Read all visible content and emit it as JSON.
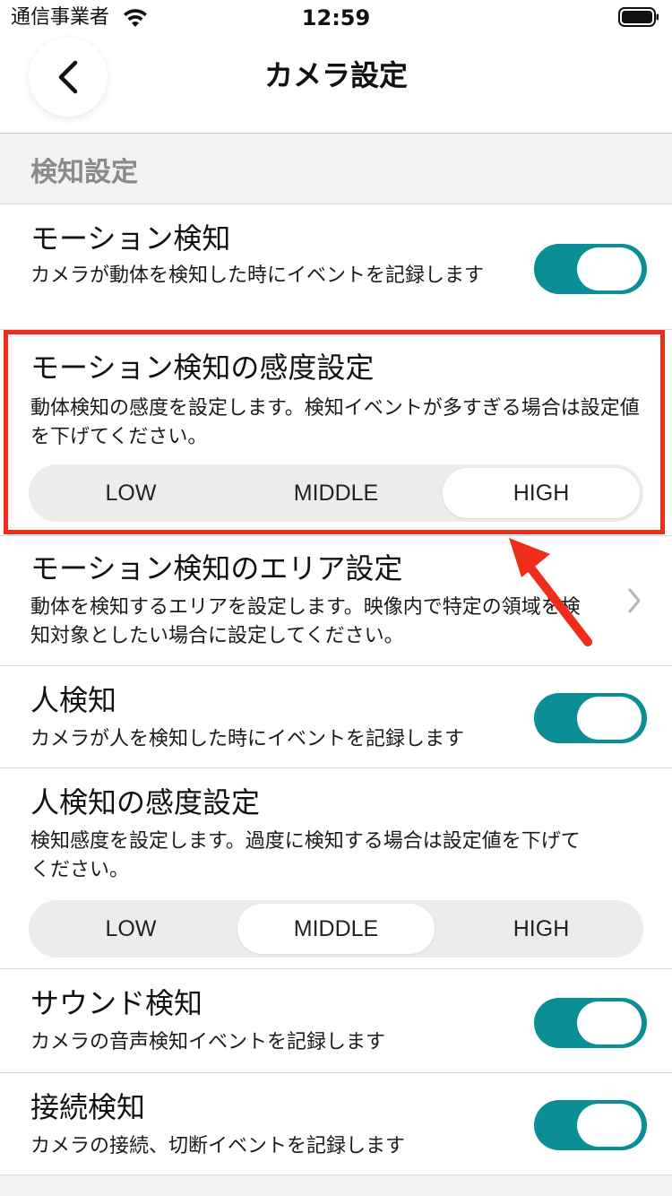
{
  "status_bar": {
    "carrier": "通信事業者",
    "time": "12:59",
    "wifi_icon": "wifi-icon",
    "battery_icon": "battery-icon"
  },
  "nav": {
    "title": "カメラ設定",
    "back_icon": "chevron-left-icon"
  },
  "section": {
    "header": "検知設定"
  },
  "rows": {
    "motion_detection": {
      "title": "モーション検知",
      "description": "カメラが動体を検知した時にイベントを記録します",
      "enabled": true
    },
    "motion_sensitivity": {
      "title": "モーション検知の感度設定",
      "description": "動体検知の感度を設定します。検知イベントが多すぎる場合は設定値を下げてください。",
      "options": [
        "LOW",
        "MIDDLE",
        "HIGH"
      ],
      "selected": "HIGH"
    },
    "motion_area": {
      "title": "モーション検知のエリア設定",
      "description": "動体を検知するエリアを設定します。映像内で特定の領域を検知対象としたい場合に設定してください。",
      "chevron_icon": "chevron-right-icon"
    },
    "person_detection": {
      "title": "人検知",
      "description": "カメラが人を検知した時にイベントを記録します",
      "enabled": true
    },
    "person_sensitivity": {
      "title": "人検知の感度設定",
      "description": "検知感度を設定します。過度に検知する場合は設定値を下げてください。",
      "options": [
        "LOW",
        "MIDDLE",
        "HIGH"
      ],
      "selected": "MIDDLE"
    },
    "sound_detection": {
      "title": "サウンド検知",
      "description": "カメラの音声検知イベントを記録します",
      "enabled": true
    },
    "connection_detection": {
      "title": "接続検知",
      "description": "カメラの接続、切断イベントを記録します",
      "enabled": true
    }
  },
  "colors": {
    "accent": "#0b8e95",
    "highlight": "#f02c1a",
    "background": "#f2f2f2",
    "section_header_text": "#8a8a8a"
  }
}
